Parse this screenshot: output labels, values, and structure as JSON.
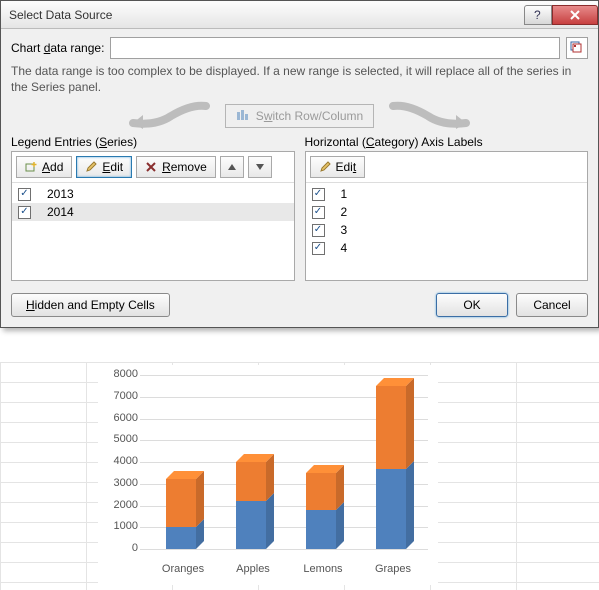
{
  "dialog": {
    "title": "Select Data Source",
    "range_label_pre": "Chart ",
    "range_label_u": "d",
    "range_label_post": "ata range:",
    "range_value": "",
    "note": "The data range is too complex to be displayed. If a new range is selected, it will replace all of the series in the Series panel.",
    "switch_pre": "S",
    "switch_u": "w",
    "switch_post": "itch Row/Column",
    "series_title_pre": "Legend Entries (",
    "series_title_u": "S",
    "series_title_post": "eries)",
    "cat_title_pre": "Horizontal (",
    "cat_title_u": "C",
    "cat_title_post": "ategory) Axis Labels",
    "add_u": "A",
    "add_post": "dd",
    "edit_u": "E",
    "edit_post": "dit",
    "remove_u": "R",
    "remove_post": "emove",
    "edit2_pre": "Edi",
    "edit2_u": "t",
    "series": [
      {
        "label": "2013",
        "checked": true,
        "selected": false
      },
      {
        "label": "2014",
        "checked": true,
        "selected": true
      }
    ],
    "categories": [
      {
        "label": "1",
        "checked": true
      },
      {
        "label": "2",
        "checked": true
      },
      {
        "label": "3",
        "checked": true
      },
      {
        "label": "4",
        "checked": true
      }
    ],
    "hidden_u": "H",
    "hidden_post": "idden and Empty Cells",
    "ok": "OK",
    "cancel": "Cancel"
  },
  "chart_data": {
    "type": "bar",
    "stacked": true,
    "categories": [
      "Oranges",
      "Apples",
      "Lemons",
      "Grapes"
    ],
    "series": [
      {
        "name": "2013",
        "color": "#4f81bd",
        "values": [
          1000,
          2200,
          1800,
          3700
        ]
      },
      {
        "name": "2014",
        "color": "#ed7d31",
        "values": [
          2200,
          1800,
          1700,
          3800
        ]
      }
    ],
    "totals": [
      3200,
      4000,
      3500,
      7500
    ],
    "yticks": [
      0,
      1000,
      2000,
      3000,
      4000,
      5000,
      6000,
      7000,
      8000
    ],
    "ylim": [
      0,
      8000
    ],
    "title": "",
    "xlabel": "",
    "ylabel": ""
  }
}
